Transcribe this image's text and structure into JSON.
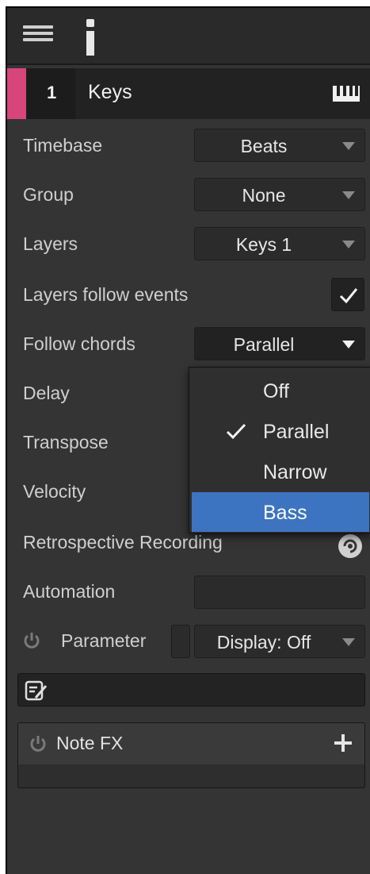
{
  "toolbar": {
    "menu_icon": "hamburger-icon",
    "info_icon": "info-icon"
  },
  "track": {
    "number": "1",
    "name": "Keys",
    "color": "#d8457a",
    "icon": "piano-keys-icon"
  },
  "properties": {
    "timebase": {
      "label": "Timebase",
      "value": "Beats"
    },
    "group": {
      "label": "Group",
      "value": "None"
    },
    "layers": {
      "label": "Layers",
      "value": "Keys 1"
    },
    "layers_follow": {
      "label": "Layers follow events",
      "checked": true
    },
    "follow_chords": {
      "label": "Follow chords",
      "value": "Parallel"
    },
    "delay": {
      "label": "Delay"
    },
    "transpose": {
      "label": "Transpose"
    },
    "velocity": {
      "label": "Velocity"
    },
    "retrospective": {
      "label": "Retrospective Recording"
    },
    "automation": {
      "label": "Automation"
    },
    "parameter": {
      "label": "Parameter",
      "display_value": "Display: Off"
    }
  },
  "notefx": {
    "label": "Note FX"
  },
  "follow_chords_menu": {
    "items": [
      {
        "label": "Off",
        "checked": false,
        "highlighted": false
      },
      {
        "label": "Parallel",
        "checked": true,
        "highlighted": false
      },
      {
        "label": "Narrow",
        "checked": false,
        "highlighted": false
      },
      {
        "label": "Bass",
        "checked": false,
        "highlighted": true
      }
    ],
    "highlight_color": "#3d74c1"
  }
}
